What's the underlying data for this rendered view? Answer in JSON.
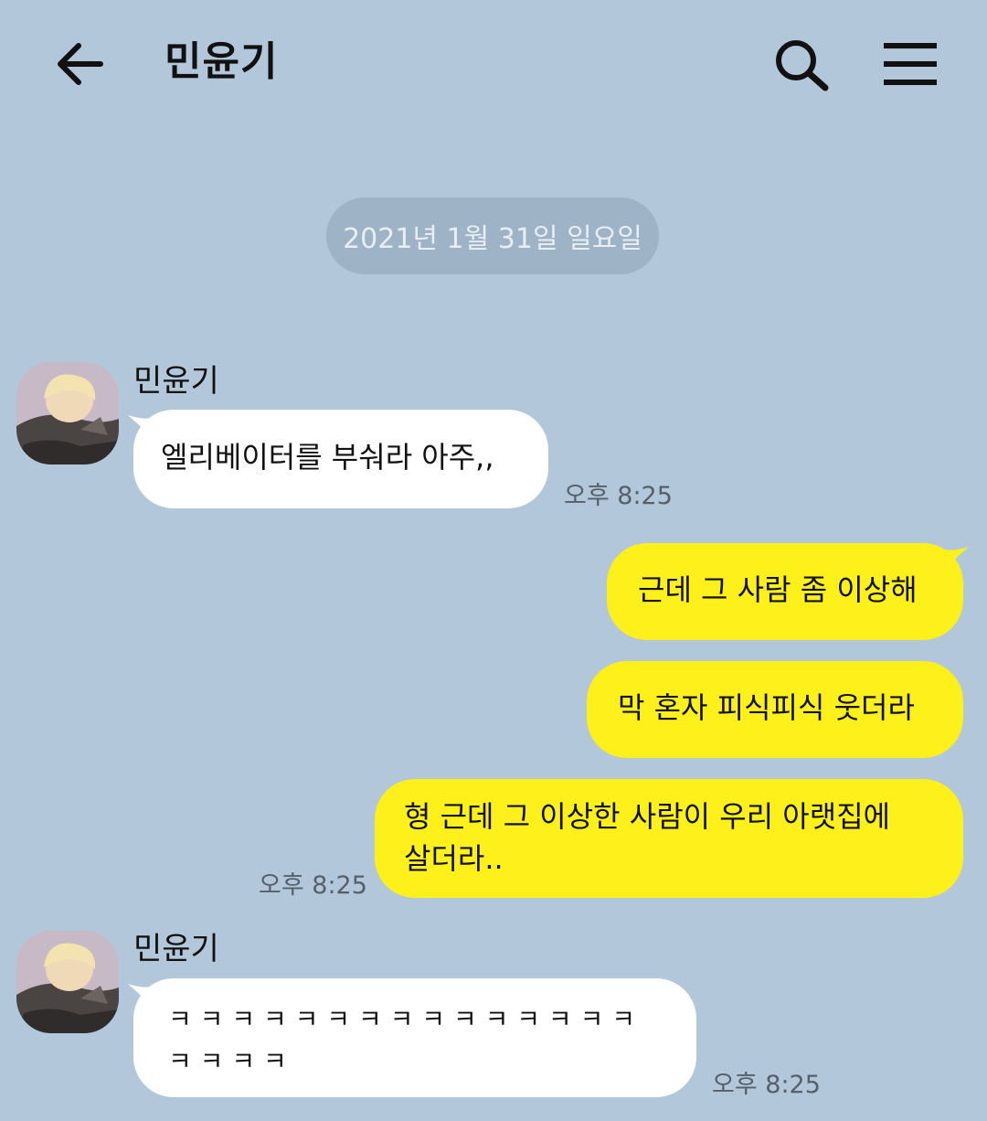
{
  "header": {
    "title": "민윤기",
    "back_icon": "arrow-left-icon",
    "search_icon": "search-icon",
    "menu_icon": "hamburger-menu-icon"
  },
  "date_divider": "2021년 1월 31일 일요일",
  "messages": [
    {
      "sender": "민윤기",
      "direction": "in",
      "text": "엘리베이터를 부숴라 아주,,",
      "time": "오후 8:25"
    },
    {
      "direction": "out",
      "text": "근데 그 사람 좀 이상해"
    },
    {
      "direction": "out",
      "text": "막 혼자 피식피식 웃더라"
    },
    {
      "direction": "out",
      "text_line1": "형 근데 그 이상한 사람이 우리 아랫집에",
      "text_line2": "살더라..",
      "time": "오후 8:25"
    },
    {
      "sender": "민윤기",
      "direction": "in",
      "text_line1": "ㅋ ㅋ ㅋ ㅋ ㅋ ㅋ ㅋ ㅋ ㅋ ㅋ ㅋ ㅋ ㅋ ㅋ ㅋ",
      "text_line2": "ㅋ ㅋ ㅋ ㅋ",
      "time": "오후 8:25"
    }
  ],
  "colors": {
    "background": "#b2c7da",
    "incoming_bubble": "#ffffff",
    "outgoing_bubble": "#fef01b",
    "date_pill": "#9fb3c6"
  }
}
